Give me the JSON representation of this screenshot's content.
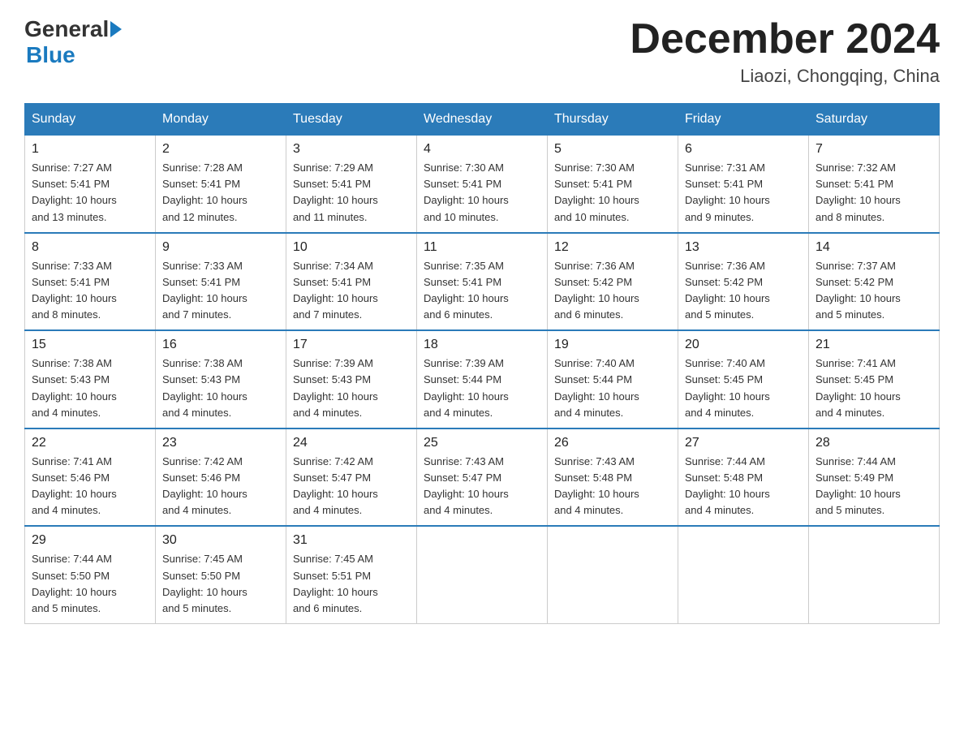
{
  "logo": {
    "general": "General",
    "blue": "Blue"
  },
  "title": "December 2024",
  "location": "Liaozi, Chongqing, China",
  "days_of_week": [
    "Sunday",
    "Monday",
    "Tuesday",
    "Wednesday",
    "Thursday",
    "Friday",
    "Saturday"
  ],
  "weeks": [
    [
      {
        "day": "1",
        "sunrise": "7:27 AM",
        "sunset": "5:41 PM",
        "daylight": "10 hours and 13 minutes."
      },
      {
        "day": "2",
        "sunrise": "7:28 AM",
        "sunset": "5:41 PM",
        "daylight": "10 hours and 12 minutes."
      },
      {
        "day": "3",
        "sunrise": "7:29 AM",
        "sunset": "5:41 PM",
        "daylight": "10 hours and 11 minutes."
      },
      {
        "day": "4",
        "sunrise": "7:30 AM",
        "sunset": "5:41 PM",
        "daylight": "10 hours and 10 minutes."
      },
      {
        "day": "5",
        "sunrise": "7:30 AM",
        "sunset": "5:41 PM",
        "daylight": "10 hours and 10 minutes."
      },
      {
        "day": "6",
        "sunrise": "7:31 AM",
        "sunset": "5:41 PM",
        "daylight": "10 hours and 9 minutes."
      },
      {
        "day": "7",
        "sunrise": "7:32 AM",
        "sunset": "5:41 PM",
        "daylight": "10 hours and 8 minutes."
      }
    ],
    [
      {
        "day": "8",
        "sunrise": "7:33 AM",
        "sunset": "5:41 PM",
        "daylight": "10 hours and 8 minutes."
      },
      {
        "day": "9",
        "sunrise": "7:33 AM",
        "sunset": "5:41 PM",
        "daylight": "10 hours and 7 minutes."
      },
      {
        "day": "10",
        "sunrise": "7:34 AM",
        "sunset": "5:41 PM",
        "daylight": "10 hours and 7 minutes."
      },
      {
        "day": "11",
        "sunrise": "7:35 AM",
        "sunset": "5:41 PM",
        "daylight": "10 hours and 6 minutes."
      },
      {
        "day": "12",
        "sunrise": "7:36 AM",
        "sunset": "5:42 PM",
        "daylight": "10 hours and 6 minutes."
      },
      {
        "day": "13",
        "sunrise": "7:36 AM",
        "sunset": "5:42 PM",
        "daylight": "10 hours and 5 minutes."
      },
      {
        "day": "14",
        "sunrise": "7:37 AM",
        "sunset": "5:42 PM",
        "daylight": "10 hours and 5 minutes."
      }
    ],
    [
      {
        "day": "15",
        "sunrise": "7:38 AM",
        "sunset": "5:43 PM",
        "daylight": "10 hours and 4 minutes."
      },
      {
        "day": "16",
        "sunrise": "7:38 AM",
        "sunset": "5:43 PM",
        "daylight": "10 hours and 4 minutes."
      },
      {
        "day": "17",
        "sunrise": "7:39 AM",
        "sunset": "5:43 PM",
        "daylight": "10 hours and 4 minutes."
      },
      {
        "day": "18",
        "sunrise": "7:39 AM",
        "sunset": "5:44 PM",
        "daylight": "10 hours and 4 minutes."
      },
      {
        "day": "19",
        "sunrise": "7:40 AM",
        "sunset": "5:44 PM",
        "daylight": "10 hours and 4 minutes."
      },
      {
        "day": "20",
        "sunrise": "7:40 AM",
        "sunset": "5:45 PM",
        "daylight": "10 hours and 4 minutes."
      },
      {
        "day": "21",
        "sunrise": "7:41 AM",
        "sunset": "5:45 PM",
        "daylight": "10 hours and 4 minutes."
      }
    ],
    [
      {
        "day": "22",
        "sunrise": "7:41 AM",
        "sunset": "5:46 PM",
        "daylight": "10 hours and 4 minutes."
      },
      {
        "day": "23",
        "sunrise": "7:42 AM",
        "sunset": "5:46 PM",
        "daylight": "10 hours and 4 minutes."
      },
      {
        "day": "24",
        "sunrise": "7:42 AM",
        "sunset": "5:47 PM",
        "daylight": "10 hours and 4 minutes."
      },
      {
        "day": "25",
        "sunrise": "7:43 AM",
        "sunset": "5:47 PM",
        "daylight": "10 hours and 4 minutes."
      },
      {
        "day": "26",
        "sunrise": "7:43 AM",
        "sunset": "5:48 PM",
        "daylight": "10 hours and 4 minutes."
      },
      {
        "day": "27",
        "sunrise": "7:44 AM",
        "sunset": "5:48 PM",
        "daylight": "10 hours and 4 minutes."
      },
      {
        "day": "28",
        "sunrise": "7:44 AM",
        "sunset": "5:49 PM",
        "daylight": "10 hours and 5 minutes."
      }
    ],
    [
      {
        "day": "29",
        "sunrise": "7:44 AM",
        "sunset": "5:50 PM",
        "daylight": "10 hours and 5 minutes."
      },
      {
        "day": "30",
        "sunrise": "7:45 AM",
        "sunset": "5:50 PM",
        "daylight": "10 hours and 5 minutes."
      },
      {
        "day": "31",
        "sunrise": "7:45 AM",
        "sunset": "5:51 PM",
        "daylight": "10 hours and 6 minutes."
      },
      null,
      null,
      null,
      null
    ]
  ],
  "labels": {
    "sunrise": "Sunrise:",
    "sunset": "Sunset:",
    "daylight": "Daylight:"
  }
}
